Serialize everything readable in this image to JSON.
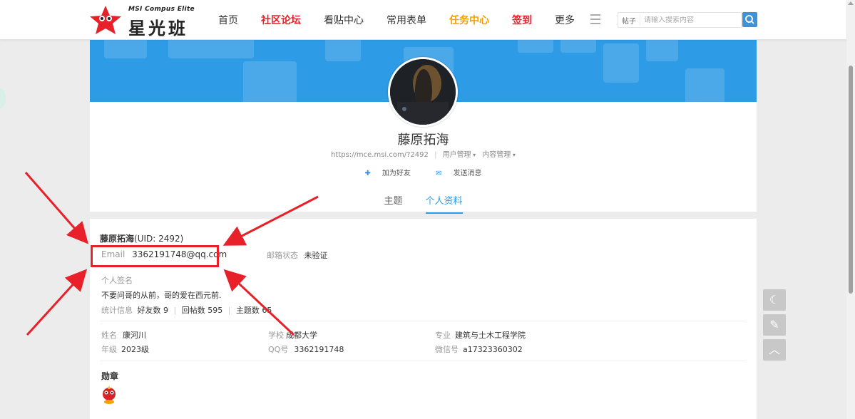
{
  "logo": {
    "sub": "MSI Compus Elite",
    "main": "星光班"
  },
  "nav": [
    {
      "label": "首页",
      "style": "normal"
    },
    {
      "label": "社区论坛",
      "style": "red"
    },
    {
      "label": "看贴中心",
      "style": "normal"
    },
    {
      "label": "常用表单",
      "style": "normal"
    },
    {
      "label": "任务中心",
      "style": "orange"
    },
    {
      "label": "签到",
      "style": "red"
    },
    {
      "label": "更多",
      "style": "normal"
    }
  ],
  "search": {
    "type": "帖子",
    "placeholder": "请输入搜索内容"
  },
  "profile": {
    "name": "藤原拓海",
    "url": "https://mce.msi.com/?2492",
    "user_manage": "用户管理",
    "content_manage": "内容管理",
    "add_friend": "加为好友",
    "send_message": "发送消息",
    "tabs": [
      "主题",
      "个人资料"
    ]
  },
  "info": {
    "name": "藤原拓海",
    "uid": "(UID: 2492)",
    "email_label": "Email",
    "email": "3362191748@qq.com",
    "email_status_label": "邮箱状态",
    "email_status": "未验证",
    "signature_label": "个人签名",
    "signature": "不要问哥的从前，哥的爱在西元前.",
    "stats_label": "统计信息",
    "friends": "好友数 9",
    "replies": "回帖数 595",
    "threads": "主题数 65",
    "realname_label": "姓名",
    "realname": "康河川",
    "school_label": "学校",
    "school": "成都大学",
    "major_label": "专业",
    "major": "建筑与土木工程学院",
    "grade_label": "年级",
    "grade": "2023级",
    "qq_label": "QQ号",
    "qq": "3362191748",
    "wechat_label": "微信号",
    "wechat": "a17323360302",
    "medal_label": "勋章"
  },
  "colors": {
    "accent": "#2d9be6",
    "red": "#e8202a",
    "orange": "#f5a000"
  }
}
